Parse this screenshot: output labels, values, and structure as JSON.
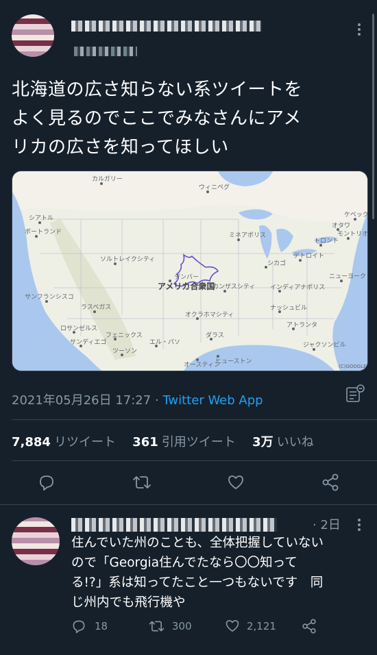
{
  "tweet": {
    "text_line1": "北海道の広さ知らない系ツイートを",
    "text_line2": "よく見るのでここでみなさんにアメ",
    "text_line3": "リカの広さを知ってほしい",
    "timestamp": "2021年05月26日 17:27",
    "separator": " · ",
    "client": "Twitter Web App",
    "stats": {
      "retweets_count": "7,884",
      "retweets_label": "リツイート",
      "quotes_count": "361",
      "quotes_label": "引用ツイート",
      "likes_count": "3万",
      "likes_label": "いいね"
    },
    "map": {
      "country_label": "アメリカ合衆国",
      "attribution": "(C)GOOGLE",
      "places": [
        "カルガリー",
        "ウィニペグ",
        "ミネアポリス",
        "シカゴ",
        "デトロイト",
        "トロント",
        "デンバー",
        "カンザスシティ",
        "オクラホマシティ",
        "ダラス",
        "ヒューストン",
        "オースティン",
        "サンフランシスコ",
        "ロサンゼルス",
        "ラスベガス",
        "フェニックス",
        "シアトル",
        "ポートランド",
        "ナッシュビル",
        "アトランタ",
        "ニューヨーク",
        "モントリオール",
        "インディアナポリス",
        "サンディエゴ",
        "エル・パソ",
        "ソルトレイクシティ",
        "ツーソン",
        "ジャクソンビル",
        "オタワ",
        "ケベック"
      ]
    }
  },
  "reply": {
    "time": "· 2日",
    "text_line1": "住んでいた州のことも、全体把握していない",
    "text_line2": "ので「Georgia住んでたなら〇〇知って",
    "text_line3": "る!?」系は知ってたこと一つもないです　同",
    "text_line4": "じ州内でも飛行機や",
    "replies": "18",
    "retweets": "300",
    "likes": "2,121"
  },
  "colors": {
    "background": "#15202b",
    "accent": "#1da1f2",
    "secondary_text": "#8899a6",
    "divider": "#38444d"
  }
}
